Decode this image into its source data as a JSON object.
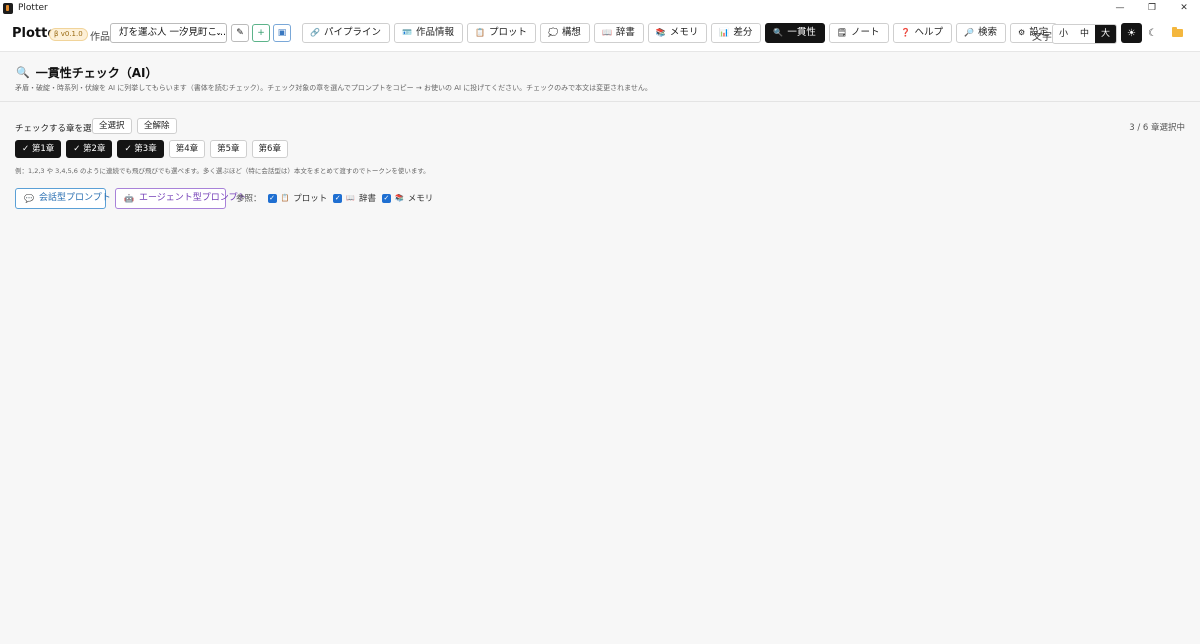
{
  "window": {
    "title": "Plotter",
    "controls": [
      "—",
      "❐",
      "✕"
    ]
  },
  "header": {
    "brand": "Plotter",
    "version": "β v0.1.0",
    "work_label": "作品",
    "work_value": "灯を運ぶ人 一汐見町こ...",
    "select_caret": "⌄",
    "pen_glyph": "✎",
    "add_glyph": "+",
    "save_glyph": "▣",
    "nav": [
      {
        "icon": "🔗",
        "label": "パイプライン",
        "active": false
      },
      {
        "icon": "🪪",
        "label": "作品情報",
        "active": false
      },
      {
        "icon": "📋",
        "label": "プロット",
        "active": false
      },
      {
        "icon": "💭",
        "label": "構想",
        "active": false
      },
      {
        "icon": "📖",
        "label": "辞書",
        "active": false
      },
      {
        "icon": "📚",
        "label": "メモリ",
        "active": false
      },
      {
        "icon": "📊",
        "label": "差分",
        "active": false
      },
      {
        "icon": "🔍",
        "label": "一貫性",
        "active": true
      },
      {
        "icon": "🗒",
        "label": "ノート",
        "active": false
      },
      {
        "icon": "❓",
        "label": "ヘルプ",
        "active": false
      },
      {
        "icon": "🔎",
        "label": "検索",
        "active": false
      },
      {
        "icon": "⚙",
        "label": "設定",
        "active": false
      }
    ],
    "font_label": "文字",
    "font_options": [
      "小",
      "中",
      "大"
    ],
    "font_selected": "大",
    "theme_light": "☀",
    "theme_dark": "☾"
  },
  "page": {
    "title_icon": "🔍",
    "title": "一貫性チェック（AI）",
    "description": "矛盾・破綻・時系列・伏線を AI に列挙してもらいます（書体を読むチェック）。チェック対象の章を選んでプロンプトをコピー → お使いの AI に投げてください。チェックのみで本文は変更されません。",
    "choose_label": "チェックする章を選ぶ",
    "select_all": "全選択",
    "clear_all": "全解除",
    "selection_count": "3 / 6 章選択中",
    "chapters": [
      {
        "label": "✓ 第1章",
        "selected": true
      },
      {
        "label": "✓ 第2章",
        "selected": true
      },
      {
        "label": "✓ 第3章",
        "selected": true
      },
      {
        "label": "第4章",
        "selected": false
      },
      {
        "label": "第5章",
        "selected": false
      },
      {
        "label": "第6章",
        "selected": false
      }
    ],
    "hint": "例：1,2,3 や 3,4,5,6 のように連続でも飛び飛びでも選べます。多く選ぶほど（特に会話型は）本文をまとめて渡すのでトークンを使います。",
    "chat_prompt": {
      "icon": "💬",
      "label": "会話型プロンプト"
    },
    "agent_prompt": {
      "icon": "🤖",
      "label": "エージェント型プロンプト"
    },
    "reference_label": "参照：",
    "references": [
      {
        "icon": "📋",
        "label": "プロット",
        "checked": true
      },
      {
        "icon": "📖",
        "label": "辞書",
        "checked": true
      },
      {
        "icon": "📚",
        "label": "メモリ",
        "checked": true
      }
    ]
  }
}
